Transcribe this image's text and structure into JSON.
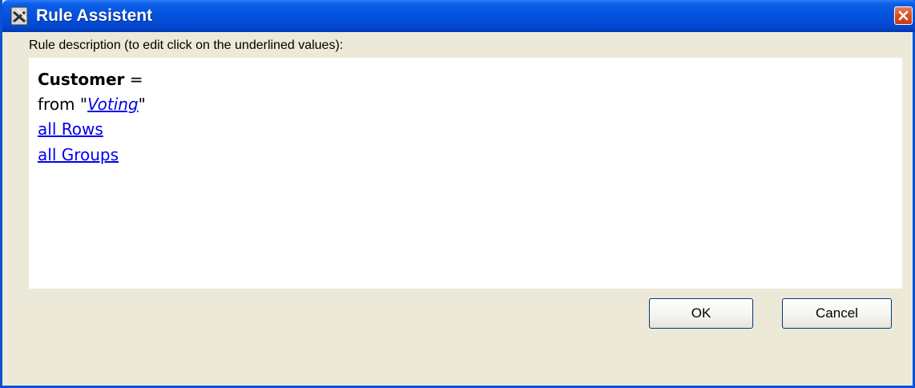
{
  "window": {
    "title": "Rule Assistent"
  },
  "dialog": {
    "description_label": "Rule description (to edit click on the underlined values):",
    "rule": {
      "target": "Customer",
      "equals": " =",
      "from_prefix": "from \"",
      "source": "Voting",
      "from_suffix": "\"",
      "rows_link": "all Rows",
      "groups_link": "all Groups"
    },
    "ok_label": "OK",
    "cancel_label": "Cancel"
  },
  "colors": {
    "titlebar": "#0451dc",
    "link": "#0000ee",
    "window_bg": "#ece9d8",
    "close_button": "#d9501f"
  },
  "icons": {
    "app_icon": "rule-assistant-app-icon",
    "close_icon": "close-icon"
  }
}
